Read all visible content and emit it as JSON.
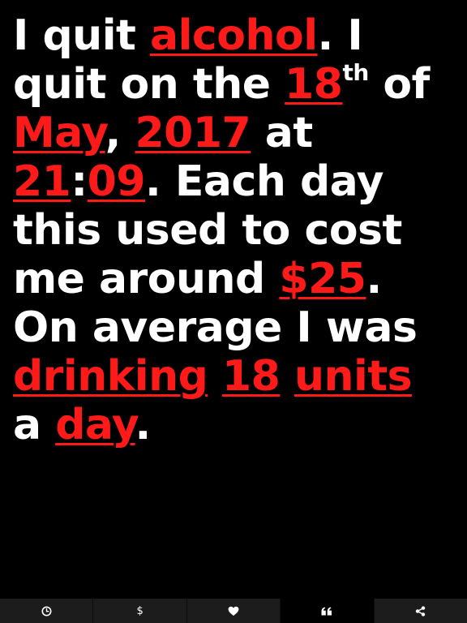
{
  "statement": {
    "line1": {
      "t1": "I quit ",
      "substance": "alcohol",
      "t2": ". I"
    },
    "line2": {
      "t1": "quit on the ",
      "day_number": "18",
      "day_suffix": "th",
      "t2": " of"
    },
    "line3": {
      "month": "May",
      "t1": ", ",
      "year": "2017",
      "t2": " at"
    },
    "line4": {
      "hour": "21",
      "sep": ":",
      "minute": "09",
      "t1": ". Each day"
    },
    "line5": {
      "t1": "this used to cost"
    },
    "line6": {
      "t1": "me around ",
      "cost": "$25",
      "t2": "."
    },
    "line7": {
      "t1": "On average I was"
    },
    "line8": {
      "verb": "drinking",
      "sp1": " ",
      "amount": "18",
      "sp2": " ",
      "unit": "units"
    },
    "line9": {
      "t1": "a ",
      "period": "day",
      "t2": "."
    }
  },
  "colors": {
    "background": "#000000",
    "text": "#ffffff",
    "editable_field": "#ff1a1a",
    "tab_inactive": "#1c1c1c",
    "tab_active": "#000000"
  },
  "tabbar": {
    "active_tab": "quote",
    "tabs": [
      {
        "id": "timer",
        "icon": "clock-icon"
      },
      {
        "id": "money",
        "icon": "dollar-icon",
        "glyph": "$"
      },
      {
        "id": "health",
        "icon": "heart-icon"
      },
      {
        "id": "quote",
        "icon": "quote-icon"
      },
      {
        "id": "share",
        "icon": "share-icon"
      }
    ]
  }
}
